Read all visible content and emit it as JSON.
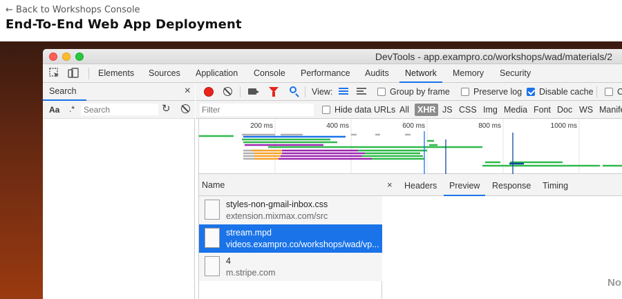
{
  "header": {
    "back_link": "← Back to Workshops Console",
    "title": "End-To-End Web App Deployment"
  },
  "window": {
    "title": "DevTools - app.exampro.co/workshops/wad/materials/2"
  },
  "tabs": [
    {
      "label": "Elements"
    },
    {
      "label": "Sources"
    },
    {
      "label": "Application"
    },
    {
      "label": "Console"
    },
    {
      "label": "Performance"
    },
    {
      "label": "Audits"
    },
    {
      "label": "Network",
      "active": true
    },
    {
      "label": "Memory"
    },
    {
      "label": "Security"
    }
  ],
  "search_pane": {
    "tab_label": "Search",
    "close_glyph": "×",
    "case_label": "Aa",
    "regex_label": ".*",
    "search_placeholder": "Search"
  },
  "network_toolbar": {
    "view_label": "View:",
    "group_by_frame": {
      "label": "Group by frame",
      "checked": false
    },
    "preserve_log": {
      "label": "Preserve log",
      "checked": false
    },
    "disable_cache": {
      "label": "Disable cache",
      "checked": true
    },
    "clipped_checkbox_label": "C"
  },
  "filter_bar": {
    "placeholder": "Filter",
    "hide_data_urls": {
      "label": "Hide data URLs",
      "checked": false
    },
    "types": [
      "All",
      "XHR",
      "JS",
      "CSS",
      "Img",
      "Media",
      "Font",
      "Doc",
      "WS",
      "Manife"
    ],
    "selected_type": "XHR"
  },
  "overview": {
    "ticks": [
      "200 ms",
      "400 ms",
      "600 ms",
      "800 ms",
      "1000 ms"
    ],
    "colors": {
      "green": "#2fb94a",
      "blue": "#1a73e8",
      "purple": "#9c27b0",
      "orange": "#f4a12b",
      "gray": "#b0b0b0",
      "dark_blue": "#0d47a1"
    }
  },
  "request_list": {
    "column_header": "Name",
    "rows": [
      {
        "name": "styles-non-gmail-inbox.css",
        "sub": "extension.mixmax.com/src",
        "selected": false
      },
      {
        "name": "stream.mpd",
        "sub": "videos.exampro.co/workshops/wad/vp...",
        "selected": true
      },
      {
        "name": "4",
        "sub": "m.stripe.com",
        "selected": false
      }
    ]
  },
  "preview_pane": {
    "close_glyph": "×",
    "tabs": [
      {
        "label": "Headers"
      },
      {
        "label": "Preview",
        "active": true
      },
      {
        "label": "Response"
      },
      {
        "label": "Timing"
      }
    ],
    "clipped_text": "No"
  }
}
